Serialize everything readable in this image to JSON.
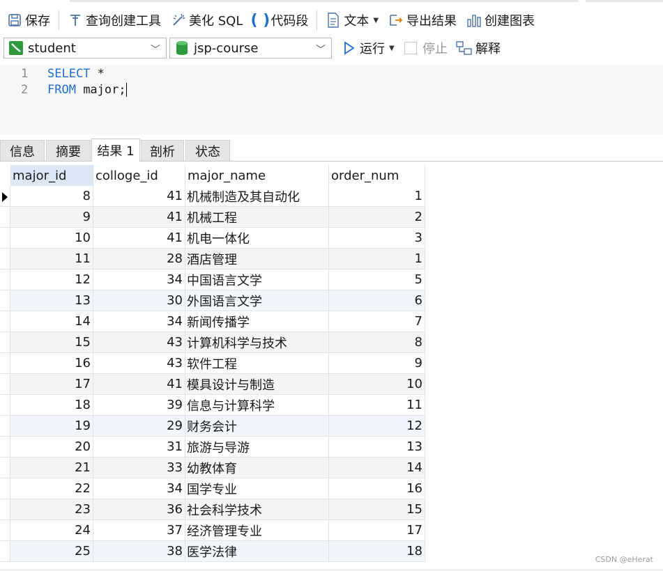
{
  "toolbar": {
    "save": "保存",
    "query_builder": "查询创建工具",
    "beautify_sql": "美化 SQL",
    "snippet": "代码段",
    "text": "文本",
    "export": "导出结果",
    "create_chart": "创建图表"
  },
  "connection": {
    "user": "student",
    "database": "jsp-course",
    "run": "运行",
    "stop": "停止",
    "explain": "解释"
  },
  "editor": {
    "lines": [
      {
        "num": "1",
        "keyword": "SELECT",
        "rest": " *"
      },
      {
        "num": "2",
        "keyword": "FROM",
        "rest": " major;"
      }
    ]
  },
  "tabs": [
    "信息",
    "摘要",
    "结果 1",
    "剖析",
    "状态"
  ],
  "active_tab": "结果 1",
  "grid": {
    "columns": [
      "major_id",
      "colloge_id",
      "major_name",
      "order_num"
    ],
    "rows": [
      [
        "8",
        "41",
        "机械制造及其自动化",
        "1"
      ],
      [
        "9",
        "41",
        "机械工程",
        "2"
      ],
      [
        "10",
        "41",
        "机电一体化",
        "3"
      ],
      [
        "11",
        "28",
        "酒店管理",
        "1"
      ],
      [
        "12",
        "34",
        "中国语言文学",
        "5"
      ],
      [
        "13",
        "30",
        "外国语言文学",
        "6"
      ],
      [
        "14",
        "34",
        "新闻传播学",
        "7"
      ],
      [
        "15",
        "43",
        "计算机科学与技术",
        "8"
      ],
      [
        "16",
        "43",
        "软件工程",
        "9"
      ],
      [
        "17",
        "41",
        "模具设计与制造",
        "10"
      ],
      [
        "18",
        "39",
        "信息与计算科学",
        "11"
      ],
      [
        "19",
        "29",
        "财务会计",
        "12"
      ],
      [
        "20",
        "31",
        "旅游与导游",
        "13"
      ],
      [
        "21",
        "33",
        "幼教体育",
        "14"
      ],
      [
        "22",
        "34",
        "国学专业",
        "16"
      ],
      [
        "23",
        "36",
        "社会科学技术",
        "15"
      ],
      [
        "24",
        "37",
        "经济管理专业",
        "17"
      ],
      [
        "25",
        "38",
        "医学法律",
        "18"
      ]
    ]
  },
  "watermark": "CSDN @eHerat",
  "colors": {
    "keyword": "#1f6fd1",
    "header_selected": "#dde8f6",
    "db_green": "#2e9a3e",
    "run_blue": "#1f6fd1"
  }
}
